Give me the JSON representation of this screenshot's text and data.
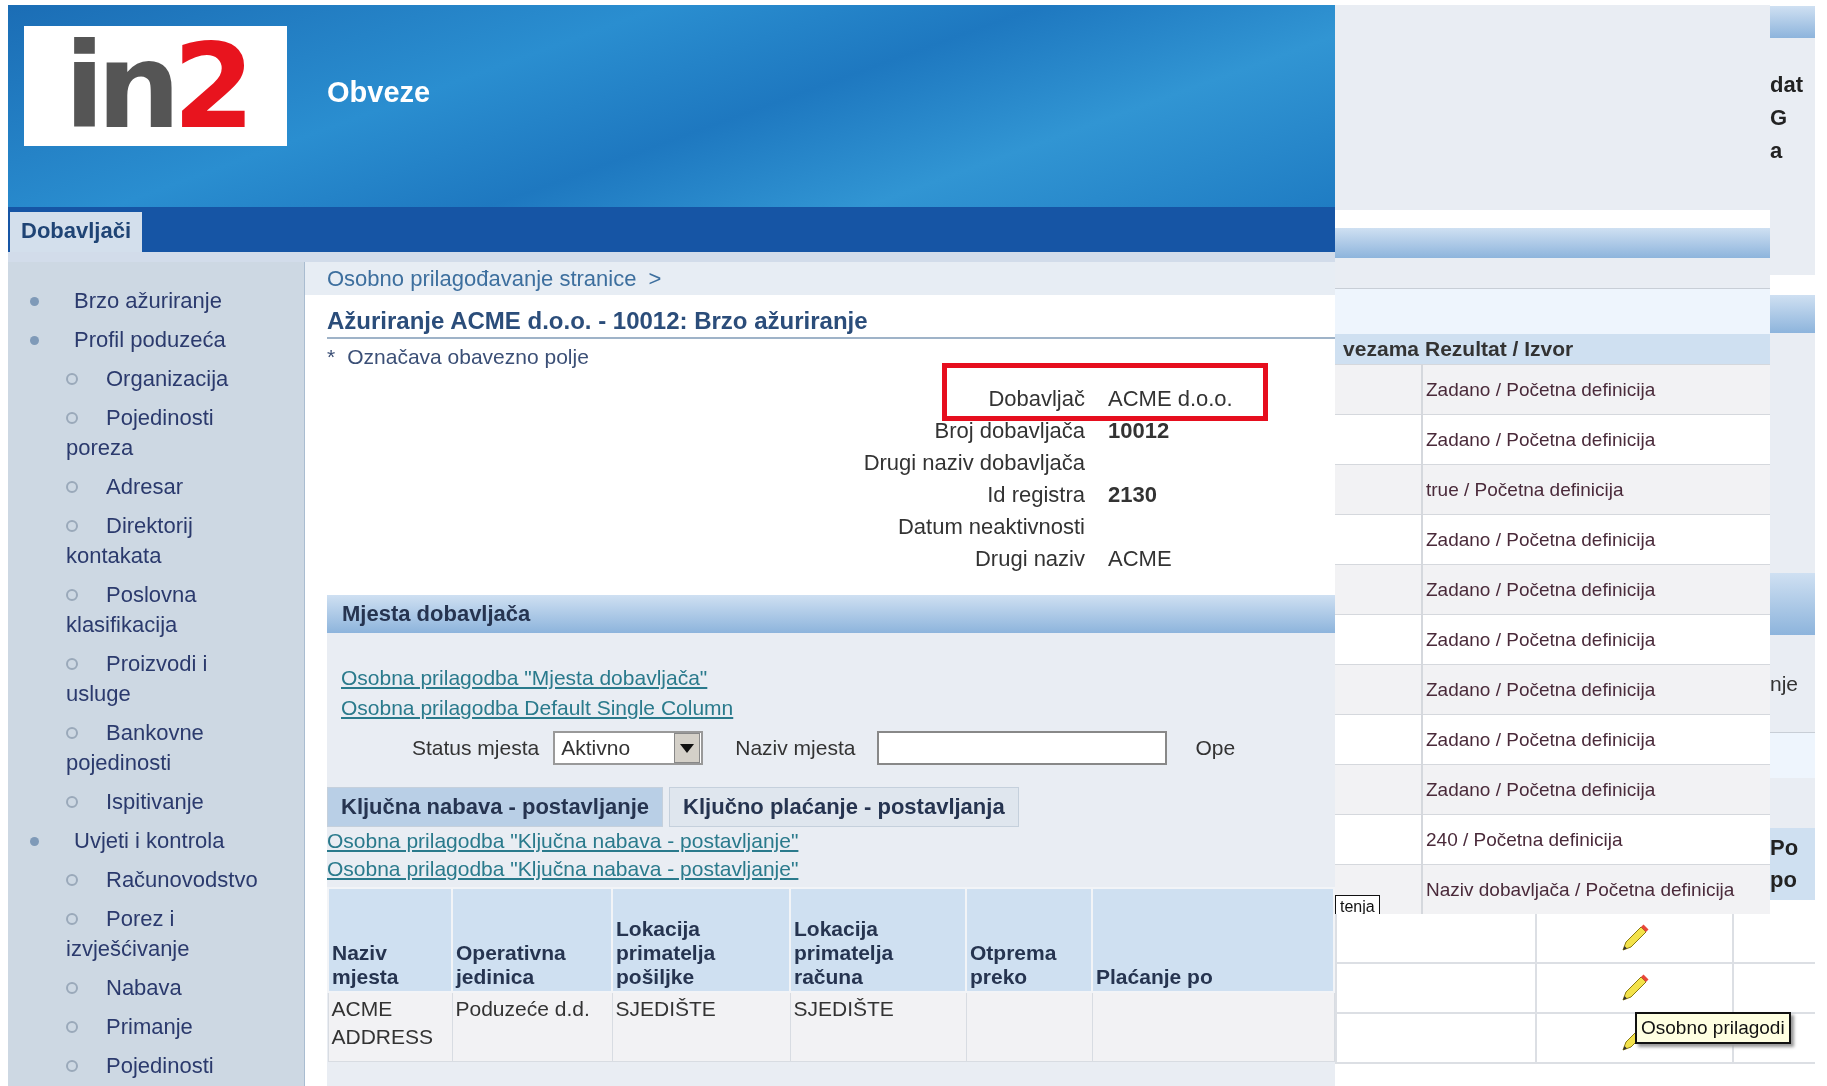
{
  "header": {
    "logo_main": "in",
    "logo_accent": "2",
    "title": "Obveze"
  },
  "tabs": [
    {
      "label": "Dobavljači",
      "selected": true
    }
  ],
  "sidebar": {
    "items": [
      {
        "label": "Brzo ažuriranje"
      },
      {
        "label": "Profil poduzeća",
        "children": [
          {
            "label": "Organizacija"
          },
          {
            "label": "Pojedinosti poreza"
          },
          {
            "label": "Adresar"
          },
          {
            "label": "Direktorij kontakata"
          },
          {
            "label": "Poslovna klasifikacija"
          },
          {
            "label": "Proizvodi i usluge"
          },
          {
            "label": "Bankovne pojedinosti"
          },
          {
            "label": "Ispitivanje"
          }
        ]
      },
      {
        "label": "Uvjeti i kontrola",
        "children": [
          {
            "label": "Računovodstvo"
          },
          {
            "label": "Porez i izvješćivanje"
          },
          {
            "label": "Nabava"
          },
          {
            "label": "Primanje"
          },
          {
            "label": "Pojedinosti"
          }
        ]
      }
    ]
  },
  "breadcrumb": {
    "text": "Osobno prilagođavanje stranice",
    "separator": ">"
  },
  "page_title": "Ažuriranje ACME d.o.o. - 10012: Brzo ažuriranje",
  "required_note": {
    "mark": "*",
    "text": "Označava obavezno polje"
  },
  "fields": [
    {
      "label": "Dobavljač",
      "value": "ACME d.o.o.",
      "bold": false,
      "highlighted": true
    },
    {
      "label": "Broj dobavljača",
      "value": "10012",
      "bold": true,
      "highlighted": false
    },
    {
      "label": "Drugi naziv dobavljača",
      "highlighted": false
    },
    {
      "label": "Id registra",
      "value": "2130",
      "bold": true,
      "highlighted": false
    },
    {
      "label": "Datum neaktivnosti",
      "highlighted": false
    },
    {
      "label": "Drugi naziv",
      "value": "ACME",
      "bold": false,
      "highlighted": false
    }
  ],
  "sites_section": {
    "title": "Mjesta dobavljača",
    "links": [
      "Osobna prilagodba \"Mjesta dobavljača\"",
      "Osobna prilagodba Default Single Column"
    ],
    "filters": [
      {
        "kind": "select",
        "label": "Status mjesta",
        "value": "Aktivno"
      },
      {
        "kind": "text",
        "label": "Naziv mjesta"
      },
      {
        "kind": "cut",
        "label": "Ope"
      }
    ]
  },
  "subtabs": [
    {
      "label": "Ključna nabava - postavljanje",
      "selected": true
    },
    {
      "label": "Ključno plaćanje - postavljanja",
      "selected": false
    }
  ],
  "subtab_links": [
    "Osobna prilagodba \"Ključna nabava - postavljanje\"",
    "Osobna prilagodba \"Ključna nabava - postavljanje\""
  ],
  "table": {
    "columns": [
      "Naziv mjesta",
      "Operativna jedinica",
      "Lokacija primatelja pošiljke",
      "Lokacija primatelja računa",
      "Otprema preko",
      "Plaćanje po"
    ],
    "rows": [
      [
        "ACME ADDRESS",
        "Poduzeće d.d.",
        "SJEDIŠTE",
        "SJEDIŠTE",
        null,
        null
      ]
    ]
  },
  "background_window": {
    "columns": [
      "vezama",
      "Rezultat / Izvor"
    ],
    "results": [
      "Zadano / Početna definicija",
      "Zadano / Početna definicija",
      "true / Početna definicija",
      "Zadano / Početna definicija",
      "Zadano / Početna definicija",
      "Zadano / Početna definicija",
      "Zadano / Početna definicija",
      "Zadano / Početna definicija",
      "Zadano / Početna definicija",
      "240 / Početna definicija",
      "Naziv dobavljača / Početna definicija"
    ],
    "tooltip": "tenja"
  },
  "side_window": {
    "texts": [
      "dat",
      "G",
      "a"
    ],
    "cut_label": "nje",
    "header_lines": [
      "Po",
      "po"
    ]
  },
  "lower_window": {
    "rows": [
      {
        "editable": true
      },
      {
        "editable": true
      },
      {
        "editable": true
      }
    ],
    "tooltip": "Osobno prilagodi"
  }
}
